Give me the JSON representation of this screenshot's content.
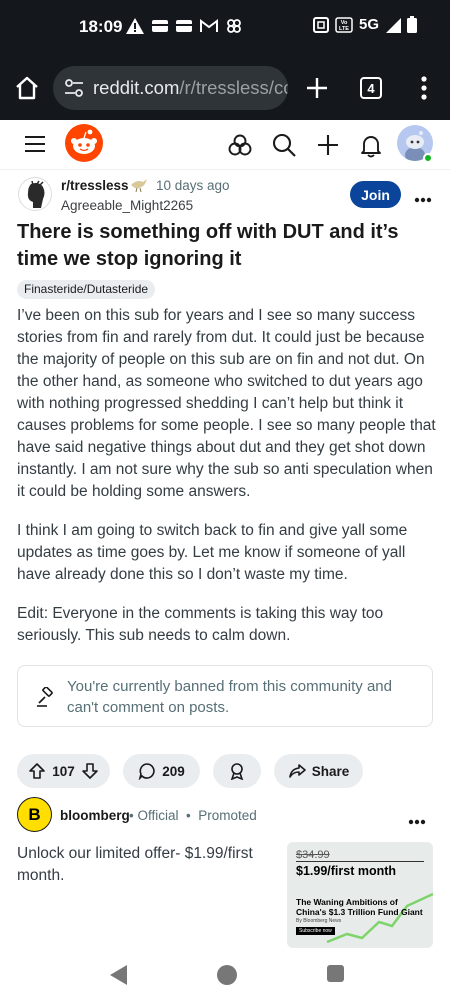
{
  "status_bar": {
    "time": "18:09",
    "network": "5G",
    "volte": "Vo LTE"
  },
  "browser": {
    "url_host": "reddit.com",
    "url_path": "/r/tressless/cc",
    "tab_count": "4"
  },
  "post": {
    "subreddit": "r/tressless",
    "age": "10 days ago",
    "author": "Agreeable_Might2265",
    "join_label": "Join",
    "title": "There is something off with DUT and it’s time we stop ignoring it",
    "flair": "Finasteride/Dutasteride",
    "paragraphs": [
      "I’ve been on this sub for years and I see so many success stories from fin and rarely from dut. It could just be because the majority of people on this sub are on fin and not dut. On the other hand, as someone who switched to dut years ago with nothing progressed shedding I can’t help but think it causes problems for some people. I see so many people that have said negative things about dut and they get shot down instantly. I am not sure why the sub so anti speculation when it could be holding some answers.",
      "I think I am going to switch back to fin and give yall some updates as time goes by. Let me know if someone of yall have already done this so I don’t waste my time.",
      "Edit: Everyone in the comments is taking this way too seriously. This sub needs to calm down."
    ],
    "ban_notice": "You're currently banned from this community and can't comment on posts.",
    "upvotes": "107",
    "comments": "209",
    "share_label": "Share"
  },
  "promoted": {
    "logo_letter": "B",
    "advertiser": "bloomberg",
    "official": "Official",
    "promoted": "Promoted",
    "text": "Unlock our limited offer- $1.99/first month.",
    "image": {
      "old_price": "$34.99",
      "price": "$1.99/first month",
      "headline": "The Waning Ambitions of China's $1.3 Trillion Fund Giant",
      "byline": "By Bloomberg News",
      "cta": "Subscribe now"
    }
  },
  "colors": {
    "join_bg": "#0a449b",
    "reddit_orange": "#ff4500",
    "pill_bg": "#eaedef",
    "bloomberg_yellow": "#ffde00"
  }
}
